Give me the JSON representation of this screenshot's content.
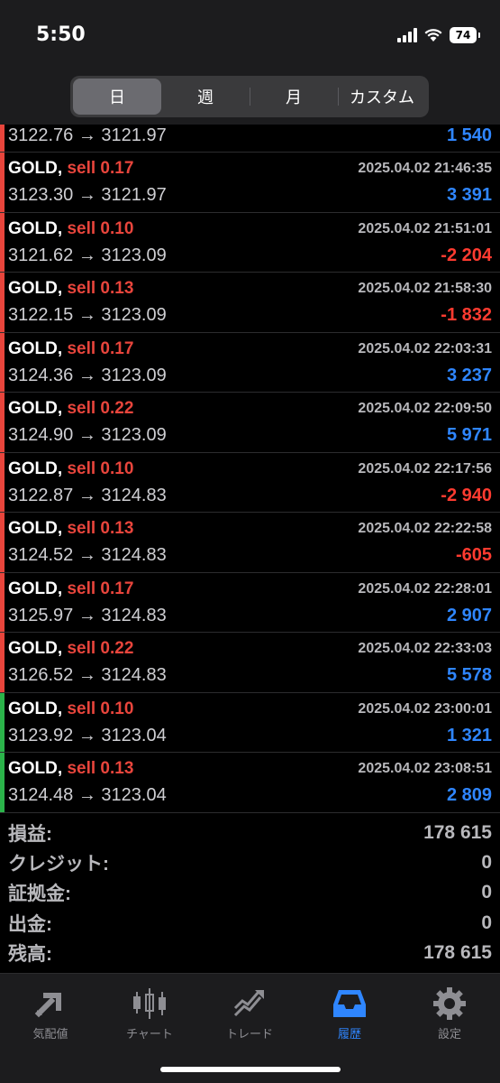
{
  "status_bar": {
    "time": "5:50",
    "battery": "74"
  },
  "period_tabs": [
    {
      "label": "日",
      "active": true
    },
    {
      "label": "週",
      "active": false
    },
    {
      "label": "月",
      "active": false
    },
    {
      "label": "カスタム",
      "active": false
    }
  ],
  "partial_row": {
    "prices": "3122.76 → 3121.97",
    "profit": "1 540",
    "profit_sign": "pos",
    "bar_color": "#e8453c"
  },
  "trades": [
    {
      "symbol": "GOLD,",
      "side": "sell 0.17",
      "time": "2025.04.02 21:46:35",
      "prices": "3123.30 → 3121.97",
      "profit": "3 391",
      "profit_sign": "pos",
      "bar_color": "#e8453c"
    },
    {
      "symbol": "GOLD,",
      "side": "sell 0.10",
      "time": "2025.04.02 21:51:01",
      "prices": "3121.62 → 3123.09",
      "profit": "-2 204",
      "profit_sign": "neg",
      "bar_color": "#e8453c"
    },
    {
      "symbol": "GOLD,",
      "side": "sell 0.13",
      "time": "2025.04.02 21:58:30",
      "prices": "3122.15 → 3123.09",
      "profit": "-1 832",
      "profit_sign": "neg",
      "bar_color": "#e8453c"
    },
    {
      "symbol": "GOLD,",
      "side": "sell 0.17",
      "time": "2025.04.02 22:03:31",
      "prices": "3124.36 → 3123.09",
      "profit": "3 237",
      "profit_sign": "pos",
      "bar_color": "#e8453c"
    },
    {
      "symbol": "GOLD,",
      "side": "sell 0.22",
      "time": "2025.04.02 22:09:50",
      "prices": "3124.90 → 3123.09",
      "profit": "5 971",
      "profit_sign": "pos",
      "bar_color": "#e8453c"
    },
    {
      "symbol": "GOLD,",
      "side": "sell 0.10",
      "time": "2025.04.02 22:17:56",
      "prices": "3122.87 → 3124.83",
      "profit": "-2 940",
      "profit_sign": "neg",
      "bar_color": "#e8453c"
    },
    {
      "symbol": "GOLD,",
      "side": "sell 0.13",
      "time": "2025.04.02 22:22:58",
      "prices": "3124.52 → 3124.83",
      "profit": "-605",
      "profit_sign": "neg",
      "bar_color": "#e8453c"
    },
    {
      "symbol": "GOLD,",
      "side": "sell 0.17",
      "time": "2025.04.02 22:28:01",
      "prices": "3125.97 → 3124.83",
      "profit": "2 907",
      "profit_sign": "pos",
      "bar_color": "#e8453c"
    },
    {
      "symbol": "GOLD,",
      "side": "sell 0.22",
      "time": "2025.04.02 22:33:03",
      "prices": "3126.52 → 3124.83",
      "profit": "5 578",
      "profit_sign": "pos",
      "bar_color": "#e8453c"
    },
    {
      "symbol": "GOLD,",
      "side": "sell 0.10",
      "time": "2025.04.02 23:00:01",
      "prices": "3123.92 → 3123.04",
      "profit": "1 321",
      "profit_sign": "pos",
      "bar_color": "#2bb34a"
    },
    {
      "symbol": "GOLD,",
      "side": "sell 0.13",
      "time": "2025.04.02 23:08:51",
      "prices": "3124.48 → 3123.04",
      "profit": "2 809",
      "profit_sign": "pos",
      "bar_color": "#2bb34a"
    }
  ],
  "summary": [
    {
      "label": "損益:",
      "value": "178 615"
    },
    {
      "label": "クレジット:",
      "value": "0"
    },
    {
      "label": "証拠金:",
      "value": "0"
    },
    {
      "label": "出金:",
      "value": "0"
    },
    {
      "label": "残高:",
      "value": "178 615"
    }
  ],
  "tabbar": [
    {
      "label": "気配値",
      "icon": "quotes-arrows-icon",
      "active": false
    },
    {
      "label": "チャート",
      "icon": "candlestick-chart-icon",
      "active": false
    },
    {
      "label": "トレード",
      "icon": "trade-trend-icon",
      "active": false
    },
    {
      "label": "履歴",
      "icon": "history-inbox-icon",
      "active": true
    },
    {
      "label": "設定",
      "icon": "gear-icon",
      "active": false
    }
  ],
  "colors": {
    "profit_positive": "#2f86ff",
    "profit_negative": "#ff3b30",
    "sell": "#e8453c",
    "accent": "#2f86ff"
  }
}
